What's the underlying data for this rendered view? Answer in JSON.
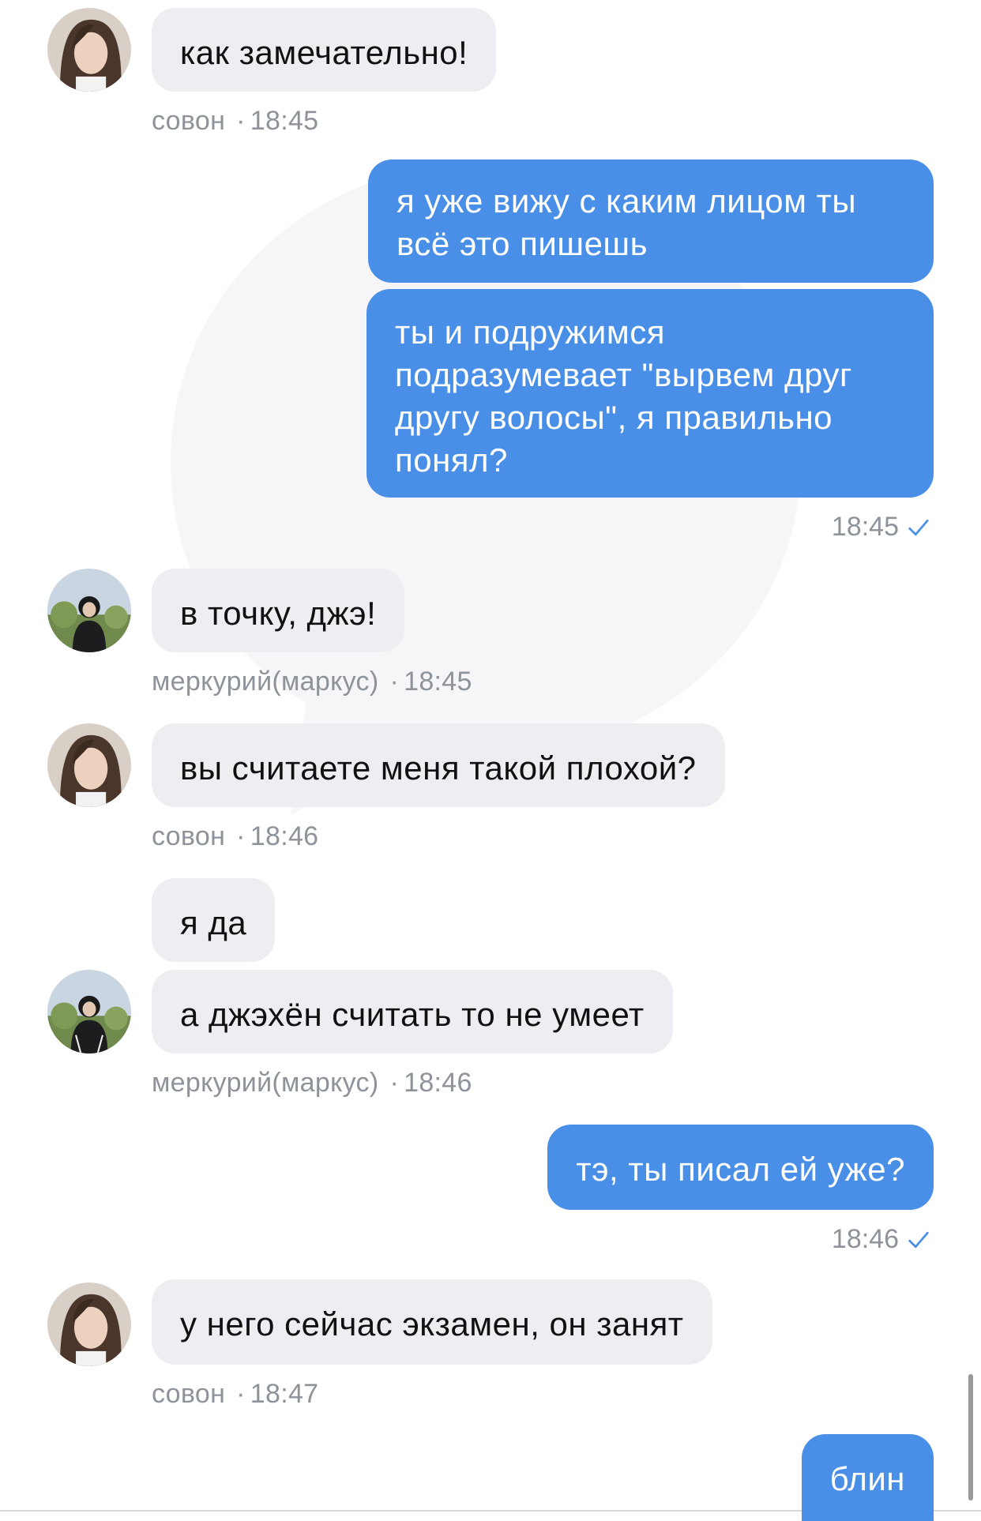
{
  "colors": {
    "incoming_bubble": "#eceef1",
    "outgoing_bubble": "#4a8fe7",
    "meta_text": "#8e939a",
    "read_check": "#4a8fe7"
  },
  "messages": [
    {
      "id": "m1",
      "direction": "in",
      "author": "совон",
      "avatar": "girl-avatar",
      "text": "как замечательно!",
      "time": "18:45"
    },
    {
      "id": "m2",
      "direction": "out",
      "text": "я уже вижу с каким лицом ты всё это пишешь"
    },
    {
      "id": "m3",
      "direction": "out",
      "text": "ты и подружимся подразумевает \"вырвем друг другу волосы\", я правильно понял?",
      "time": "18:45",
      "status_icon": "read-check-icon"
    },
    {
      "id": "m4",
      "direction": "in",
      "author": "меркурий(маркус)",
      "avatar": "boy-avatar",
      "text": "в точку, джэ!",
      "time": "18:45"
    },
    {
      "id": "m5",
      "direction": "in",
      "author": "совон",
      "avatar": "girl-avatar",
      "text": "вы считаете меня такой плохой?",
      "time": "18:46"
    },
    {
      "id": "m6",
      "direction": "in",
      "text": "я да"
    },
    {
      "id": "m7",
      "direction": "in",
      "author": "меркурий(маркус)",
      "avatar": "boy-avatar",
      "text": "а джэхён считать то не умеет",
      "time": "18:46"
    },
    {
      "id": "m8",
      "direction": "out",
      "text": "тэ, ты писал ей уже?",
      "time": "18:46",
      "status_icon": "read-check-icon"
    },
    {
      "id": "m9",
      "direction": "in",
      "author": "совон",
      "avatar": "girl-avatar",
      "text": "у него сейчас экзамен, он занят",
      "time": "18:47"
    },
    {
      "id": "m10",
      "direction": "out",
      "text": "блин"
    }
  ]
}
